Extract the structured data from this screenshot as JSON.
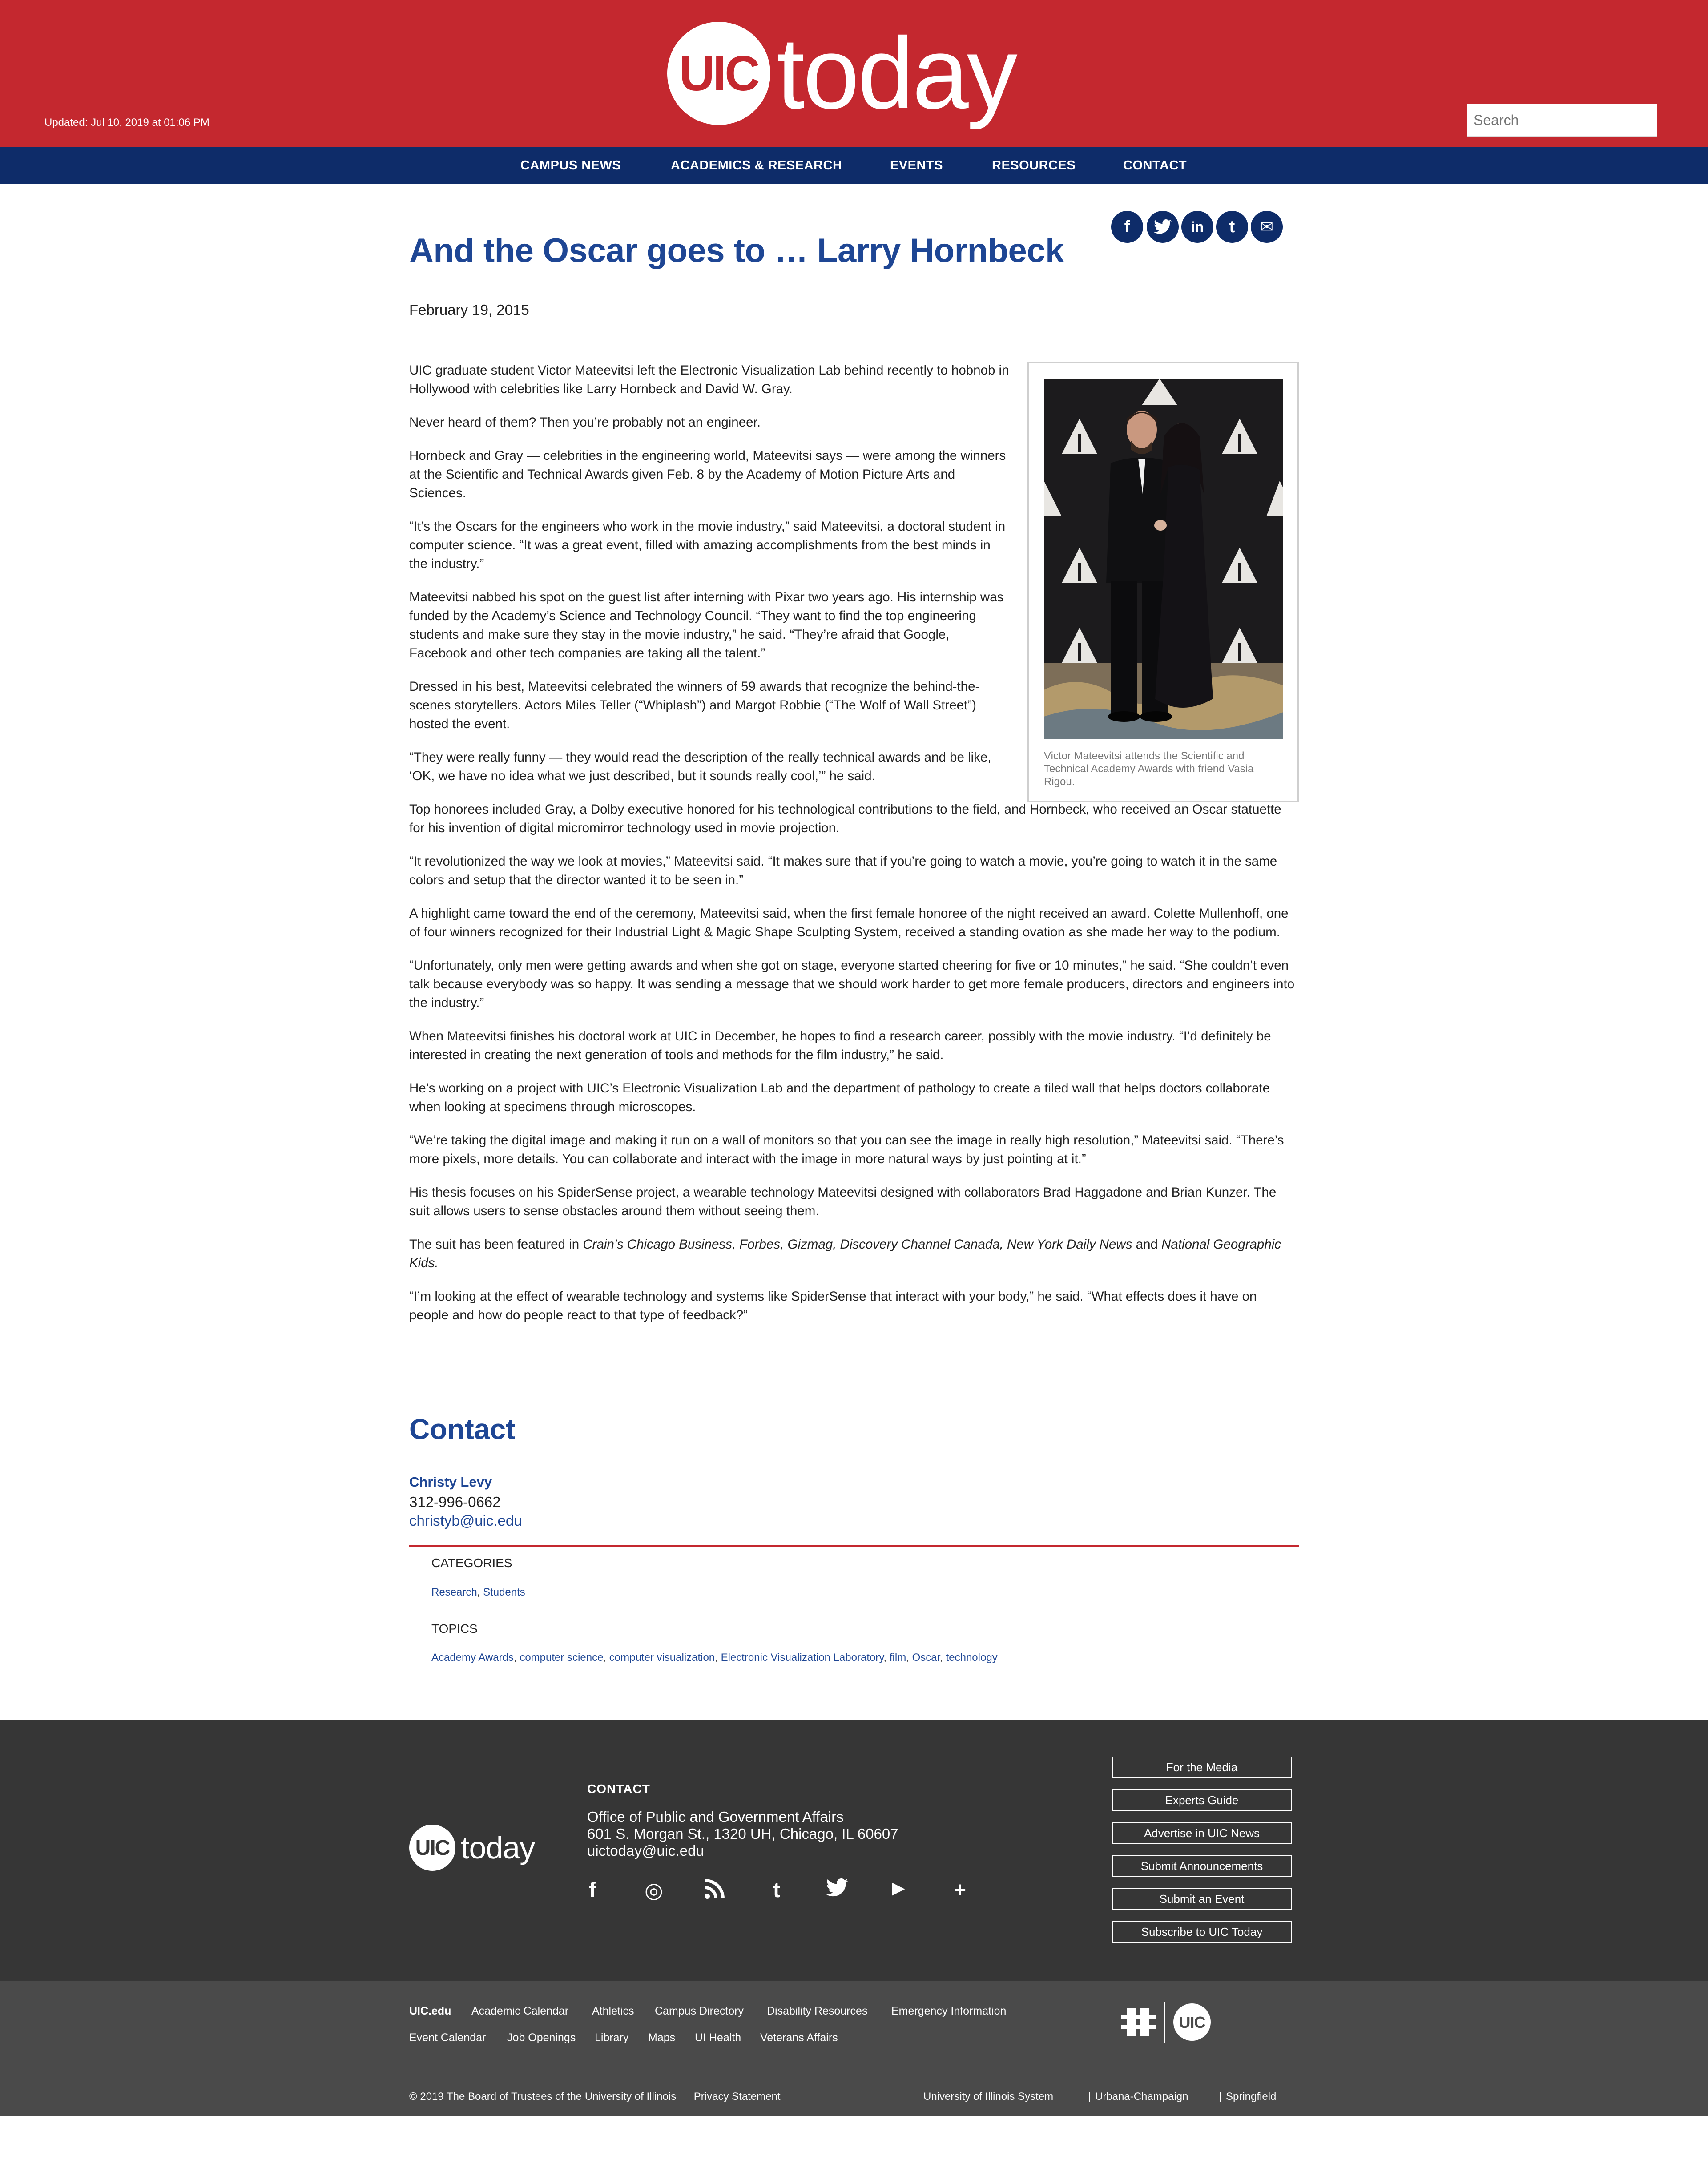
{
  "header": {
    "updated": "Updated: Jul 10, 2019 at 01:06 PM",
    "logo_mark": "UIC",
    "logo_word": "today",
    "search_placeholder": "Search",
    "brand_color": "#c4282f",
    "nav_color": "#0e2c69"
  },
  "nav": {
    "items": [
      "CAMPUS NEWS",
      "ACADEMICS & RESEARCH",
      "EVENTS",
      "RESOURCES",
      "CONTACT"
    ]
  },
  "share": {
    "icons": [
      "facebook-icon",
      "twitter-icon",
      "linkedin-icon",
      "tumblr-icon",
      "email-icon"
    ],
    "glyphs": [
      "f",
      "t",
      "in",
      "t",
      "✉"
    ]
  },
  "article": {
    "title": "And the Oscar goes to … Larry Hornbeck",
    "date": "February 19, 2015",
    "paragraphs": [
      "UIC graduate student Victor Mateevitsi left the Electronic Visualization Lab behind recently to hobnob in Hollywood with celebrities like Larry Hornbeck and David W. Gray.",
      "Never heard of them? Then you’re probably not an engineer.",
      "Hornbeck and Gray — celebrities in the engineering world, Mateevitsi says — were among the winners at the Scientific and Technical Awards given Feb. 8 by the Academy of Motion Picture Arts and Sciences.",
      "“It’s the Oscars for the engineers who work in the movie industry,” said Mateevitsi, a doctoral student in computer science. “It was a great event, filled with amazing accomplishments from the best minds in the industry.”",
      "Mateevitsi nabbed his spot on the guest list after interning with Pixar two years ago. His internship was funded by the Academy’s Science and Technology Council. “They want to find the top engineering students and make sure they stay in the movie industry,” he said. “They’re afraid that Google, Facebook and other tech companies are taking all the talent.”",
      "Dressed in his best, Mateevitsi celebrated the winners of 59 awards that recognize the behind-the-scenes storytellers. Actors Miles Teller (“Whiplash”) and Margot Robbie (“The Wolf of Wall Street”) hosted the event.",
      "“They were really funny — they would read the description of the really technical awards and be like, ‘OK, we have no idea what we just described, but it sounds really cool,’” he said.",
      "Top honorees included Gray, a Dolby executive honored for his technological contributions to the field, and Hornbeck, who received an Oscar statuette for his invention of digital micromirror technology used in movie projection.",
      "“It revolutionized the way we look at movies,” Mateevitsi said. “It makes sure that if you’re going to watch a movie, you’re going to watch it in the same colors and setup that the director wanted it to be seen in.”",
      "A highlight came toward the end of the ceremony, Mateevitsi said, when the first female honoree of the night received an award. Colette Mullenhoff, one of four winners recognized for their Industrial Light & Magic Shape Sculpting System, received a standing ovation as she made her way to the podium.",
      "“Unfortunately, only men were getting awards and when she got on stage, everyone started cheering for five or 10 minutes,” he said. “She couldn’t even talk because everybody was so happy. It was sending a message that we should work harder to get more female producers, directors and engineers into the industry.”",
      "When Mateevitsi finishes his doctoral work at UIC in December, he hopes to find a research career, possibly with the movie industry.  “I’d definitely be interested in creating the next generation of tools and methods for the film industry,” he said.",
      "He’s working on a project with UIC’s Electronic Visualization Lab and the department of pathology to create a tiled wall that helps doctors collaborate when looking at specimens through microscopes.",
      "“We’re taking the digital image and making it run on a wall of monitors so that you can see the image in really high resolution,” Mateevitsi said. “There’s more pixels, more details. You can collaborate and interact with the image in more natural ways by just pointing at it.”",
      "His thesis focuses on his SpiderSense project, a wearable technology Mateevitsi designed with collaborators Brad Haggadone and Brian Kunzer. The suit allows users to sense obstacles around them without seeing them."
    ],
    "featured_prefix": "The suit has been featured in ",
    "featured_italic_1": "Crain’s Chicago Business, Forbes, Gizmag, Discovery Channel Canada, New York Daily News",
    "featured_and": " and ",
    "featured_italic_2": "National Geographic Kids.",
    "last_paragraph": "“I’m looking at the effect of wearable technology and systems like SpiderSense that interact with your body,” he said. “What effects does it have on people and how do people react to that type of feedback?”",
    "figure_caption": "Victor Mateevitsi attends the Scientific and Technical Academy Awards with friend Vasia Rigou."
  },
  "contact": {
    "heading": "Contact",
    "name": "Christy Levy",
    "phone": "312-996-0662",
    "email": "christyb@uic.edu"
  },
  "taxonomy": {
    "categories_label": "CATEGORIES",
    "categories": [
      "Research",
      "Students"
    ],
    "topics_label": "TOPICS",
    "topics": [
      "Academy Awards",
      "computer science",
      "computer visualization",
      "Electronic Visualization Laboratory",
      "film",
      "Oscar",
      "technology"
    ]
  },
  "footer": {
    "logo_mark": "UIC",
    "logo_word": "today",
    "contact_label": "CONTACT",
    "office": "Office of Public and Government Affairs",
    "address": "601 S. Morgan St., 1320 UH, Chicago, IL 60607",
    "email": "uictoday@uic.edu",
    "social_icons": [
      "facebook-icon",
      "instagram-icon",
      "rss-icon",
      "tumblr-icon",
      "twitter-icon",
      "youtube-icon",
      "plus-icon"
    ],
    "social_glyphs": [
      "f",
      "◎",
      "☰",
      "t",
      "♥",
      "▶",
      "+"
    ],
    "buttons": [
      "For the Media",
      "Experts Guide",
      "Advertise in UIC News",
      "Submit Announcements",
      "Submit an Event",
      "Subscribe to UIC Today"
    ],
    "links_row1": [
      "UIC.edu",
      "Academic Calendar",
      "Athletics",
      "Campus Directory",
      "Disability Resources",
      "Emergency Information"
    ],
    "links_row2": [
      "Event Calendar",
      "Job Openings",
      "Library",
      "Maps",
      "UI Health",
      "Veterans Affairs"
    ],
    "mark_text": "UIC",
    "copyright": "© 2019 The Board of Trustees of the University of Illinois",
    "privacy": "Privacy Statement",
    "system_links": [
      "University of Illinois System",
      "Urbana-Champaign",
      "Springfield"
    ]
  }
}
